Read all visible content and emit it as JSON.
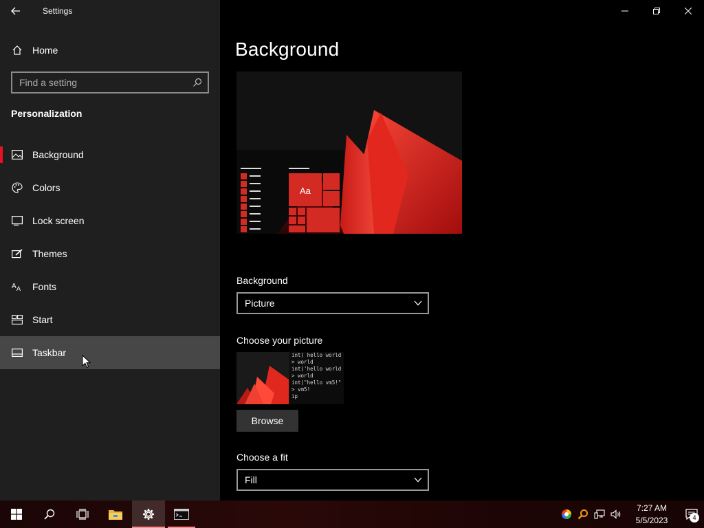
{
  "window": {
    "title": "Settings"
  },
  "sidebar": {
    "home_label": "Home",
    "search_placeholder": "Find a setting",
    "section_title": "Personalization",
    "items": [
      {
        "label": "Background",
        "icon": "picture-icon",
        "selected": true
      },
      {
        "label": "Colors",
        "icon": "palette-icon"
      },
      {
        "label": "Lock screen",
        "icon": "lock-screen-icon"
      },
      {
        "label": "Themes",
        "icon": "themes-icon"
      },
      {
        "label": "Fonts",
        "icon": "fonts-icon"
      },
      {
        "label": "Start",
        "icon": "start-icon"
      },
      {
        "label": "Taskbar",
        "icon": "taskbar-icon",
        "hover": true
      }
    ]
  },
  "main": {
    "page_title": "Background",
    "preview_tile_text": "Aa",
    "background_label": "Background",
    "background_value": "Picture",
    "choose_picture_label": "Choose your picture",
    "thumbnail_code_lines": [
      "int( hello world",
      "> world",
      "int('hello world",
      "> world",
      "int(\"hello vm5!\"",
      "> vm5!",
      "ip"
    ],
    "browse_label": "Browse",
    "choose_fit_label": "Choose a fit",
    "fit_value": "Fill"
  },
  "taskbar": {
    "time": "7:27 AM",
    "date": "5/5/2023",
    "notification_count": "4"
  },
  "colors": {
    "accent": "#e81123",
    "sidebar_bg": "#1f1f1f",
    "hover_bg": "#474747"
  }
}
